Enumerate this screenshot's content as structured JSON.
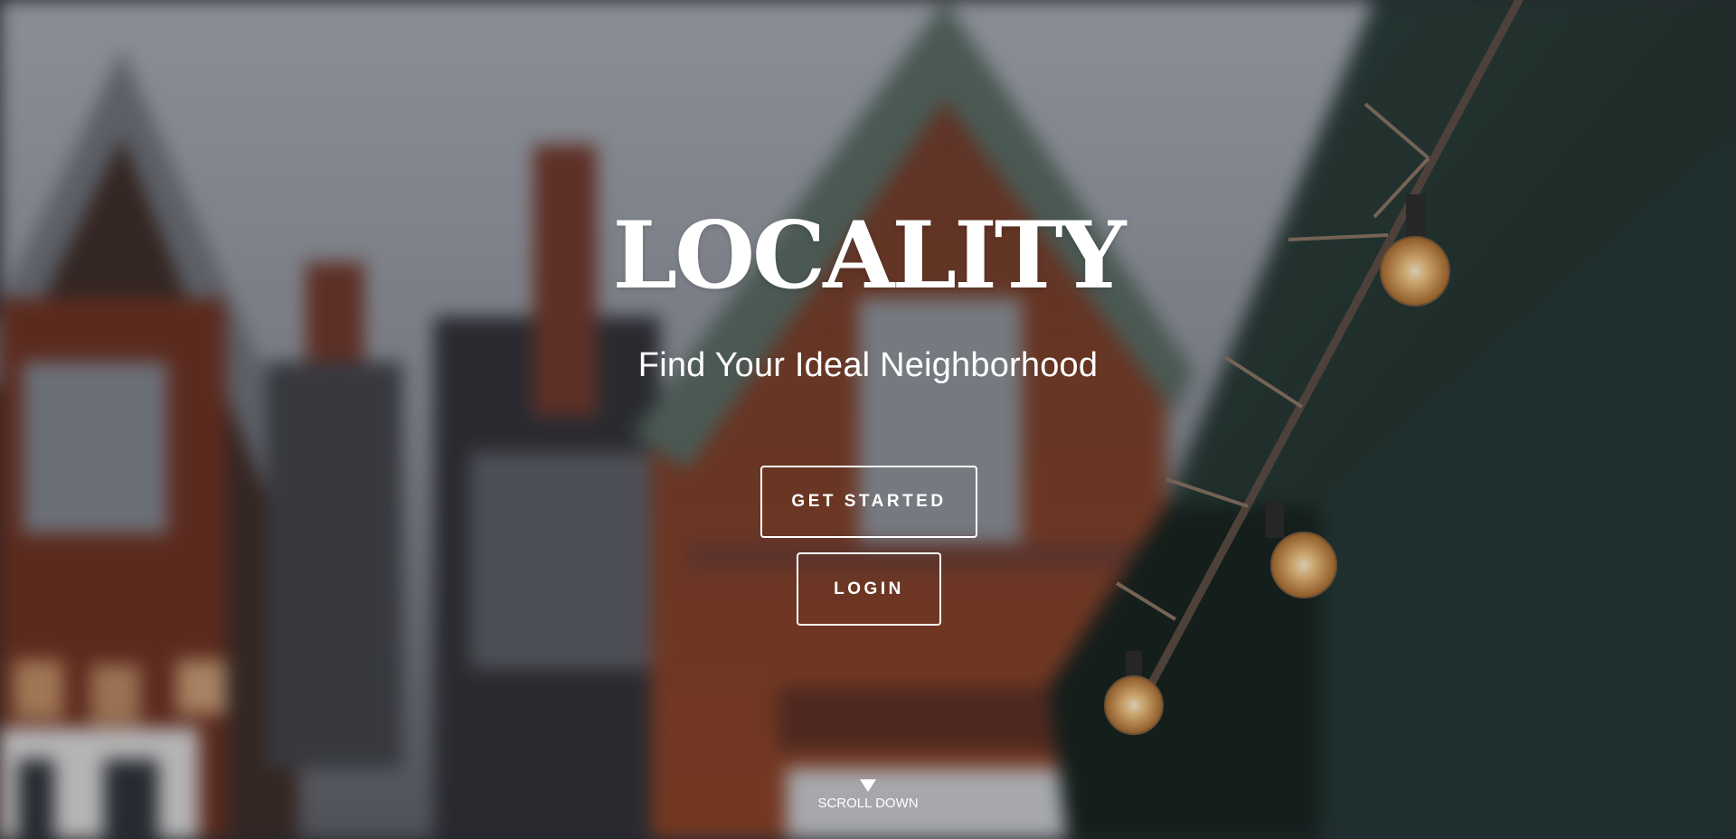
{
  "hero": {
    "title": "LOCALITY",
    "subtitle": "Find Your Ideal Neighborhood"
  },
  "actions": {
    "get_started_label": "GET STARTED",
    "login_label": "LOGIN"
  },
  "scroll": {
    "label": "SCROLL DOWN",
    "icon": "triangle-down-icon"
  },
  "colors": {
    "text": "#ffffff",
    "sky": "#9ea3ab",
    "brick": "#7a3a22",
    "awning": "#1f332f",
    "bulb": "#f2c98a"
  }
}
